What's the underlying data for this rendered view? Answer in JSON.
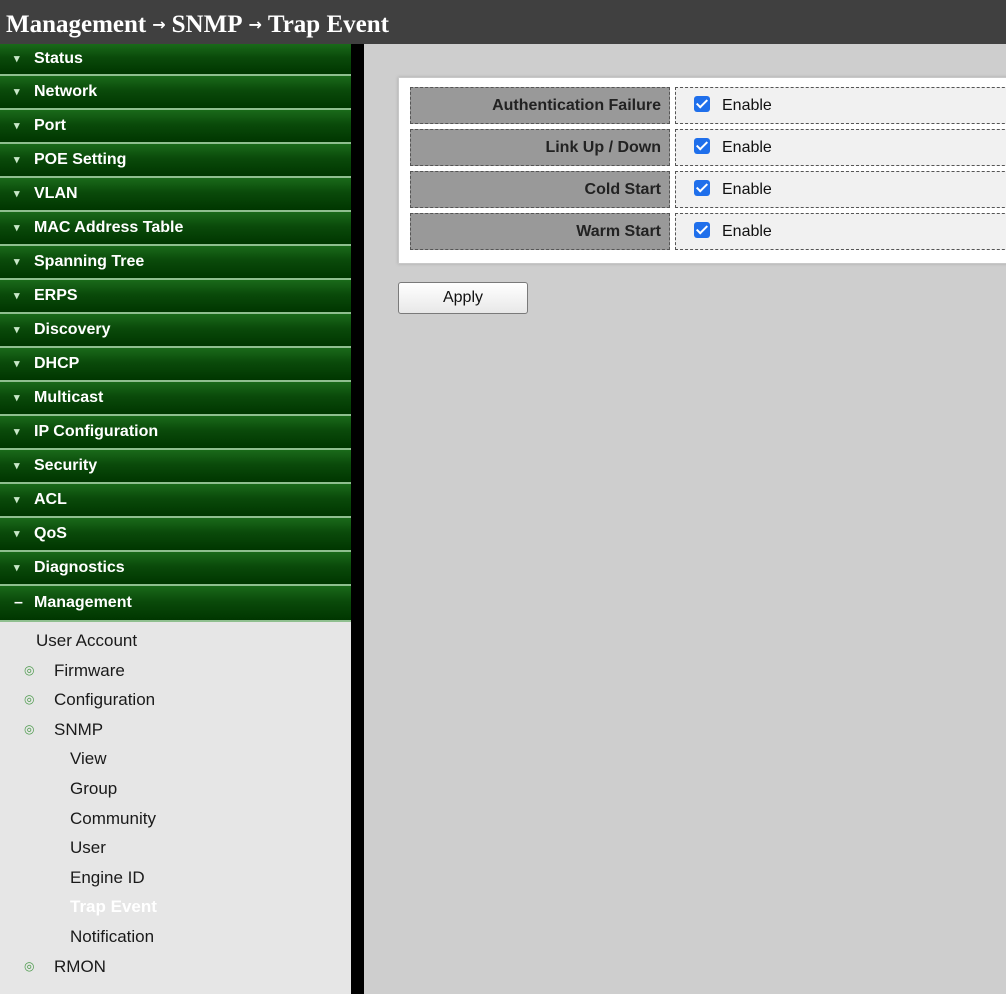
{
  "breadcrumb": {
    "part1": "Management",
    "part2": "SNMP",
    "part3": "Trap Event",
    "sep": "→"
  },
  "sidebar": {
    "menu": [
      "Status",
      "Network",
      "Port",
      "POE Setting",
      "VLAN",
      "MAC Address Table",
      "Spanning Tree",
      "ERPS",
      "Discovery",
      "DHCP",
      "Multicast",
      "IP Configuration",
      "Security",
      "ACL",
      "QoS",
      "Diagnostics"
    ],
    "open_menu": "Management",
    "sub": {
      "user_account": "User Account",
      "firmware": "Firmware",
      "configuration": "Configuration",
      "snmp": "SNMP",
      "view": "View",
      "group": "Group",
      "community": "Community",
      "user": "User",
      "engine_id": "Engine ID",
      "trap_event": "Trap Event",
      "notification": "Notification",
      "rmon": "RMON"
    }
  },
  "form": {
    "rows": [
      {
        "label": "Authentication Failure",
        "value": "Enable",
        "checked": true
      },
      {
        "label": "Link Up / Down",
        "value": "Enable",
        "checked": true
      },
      {
        "label": "Cold Start",
        "value": "Enable",
        "checked": true
      },
      {
        "label": "Warm Start",
        "value": "Enable",
        "checked": true
      }
    ],
    "apply_label": "Apply"
  }
}
